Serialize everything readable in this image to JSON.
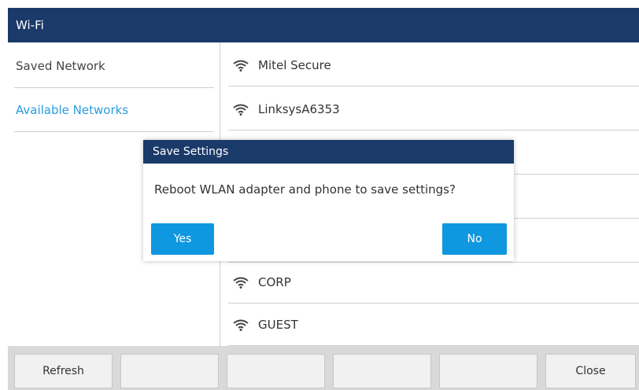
{
  "window": {
    "title": "Wi-Fi"
  },
  "sidebar": {
    "items": [
      {
        "label": "Saved Network"
      },
      {
        "label": "Available Networks"
      }
    ]
  },
  "networks": [
    {
      "name": "Mitel Secure"
    },
    {
      "name": "LinksysA6353"
    },
    {
      "name": ""
    },
    {
      "name": ""
    },
    {
      "name": ""
    },
    {
      "name": "CORP"
    },
    {
      "name": "GUEST"
    }
  ],
  "dialog": {
    "title": "Save Settings",
    "message": "Reboot WLAN adapter and phone to save settings?",
    "yes_label": "Yes",
    "no_label": "No"
  },
  "softkeys": {
    "refresh": "Refresh",
    "close": "Close"
  },
  "colors": {
    "header": "#1a3a6a",
    "accent": "#2a9be0",
    "button": "#0f97e0"
  },
  "icons": {
    "network": "wifi-icon"
  }
}
